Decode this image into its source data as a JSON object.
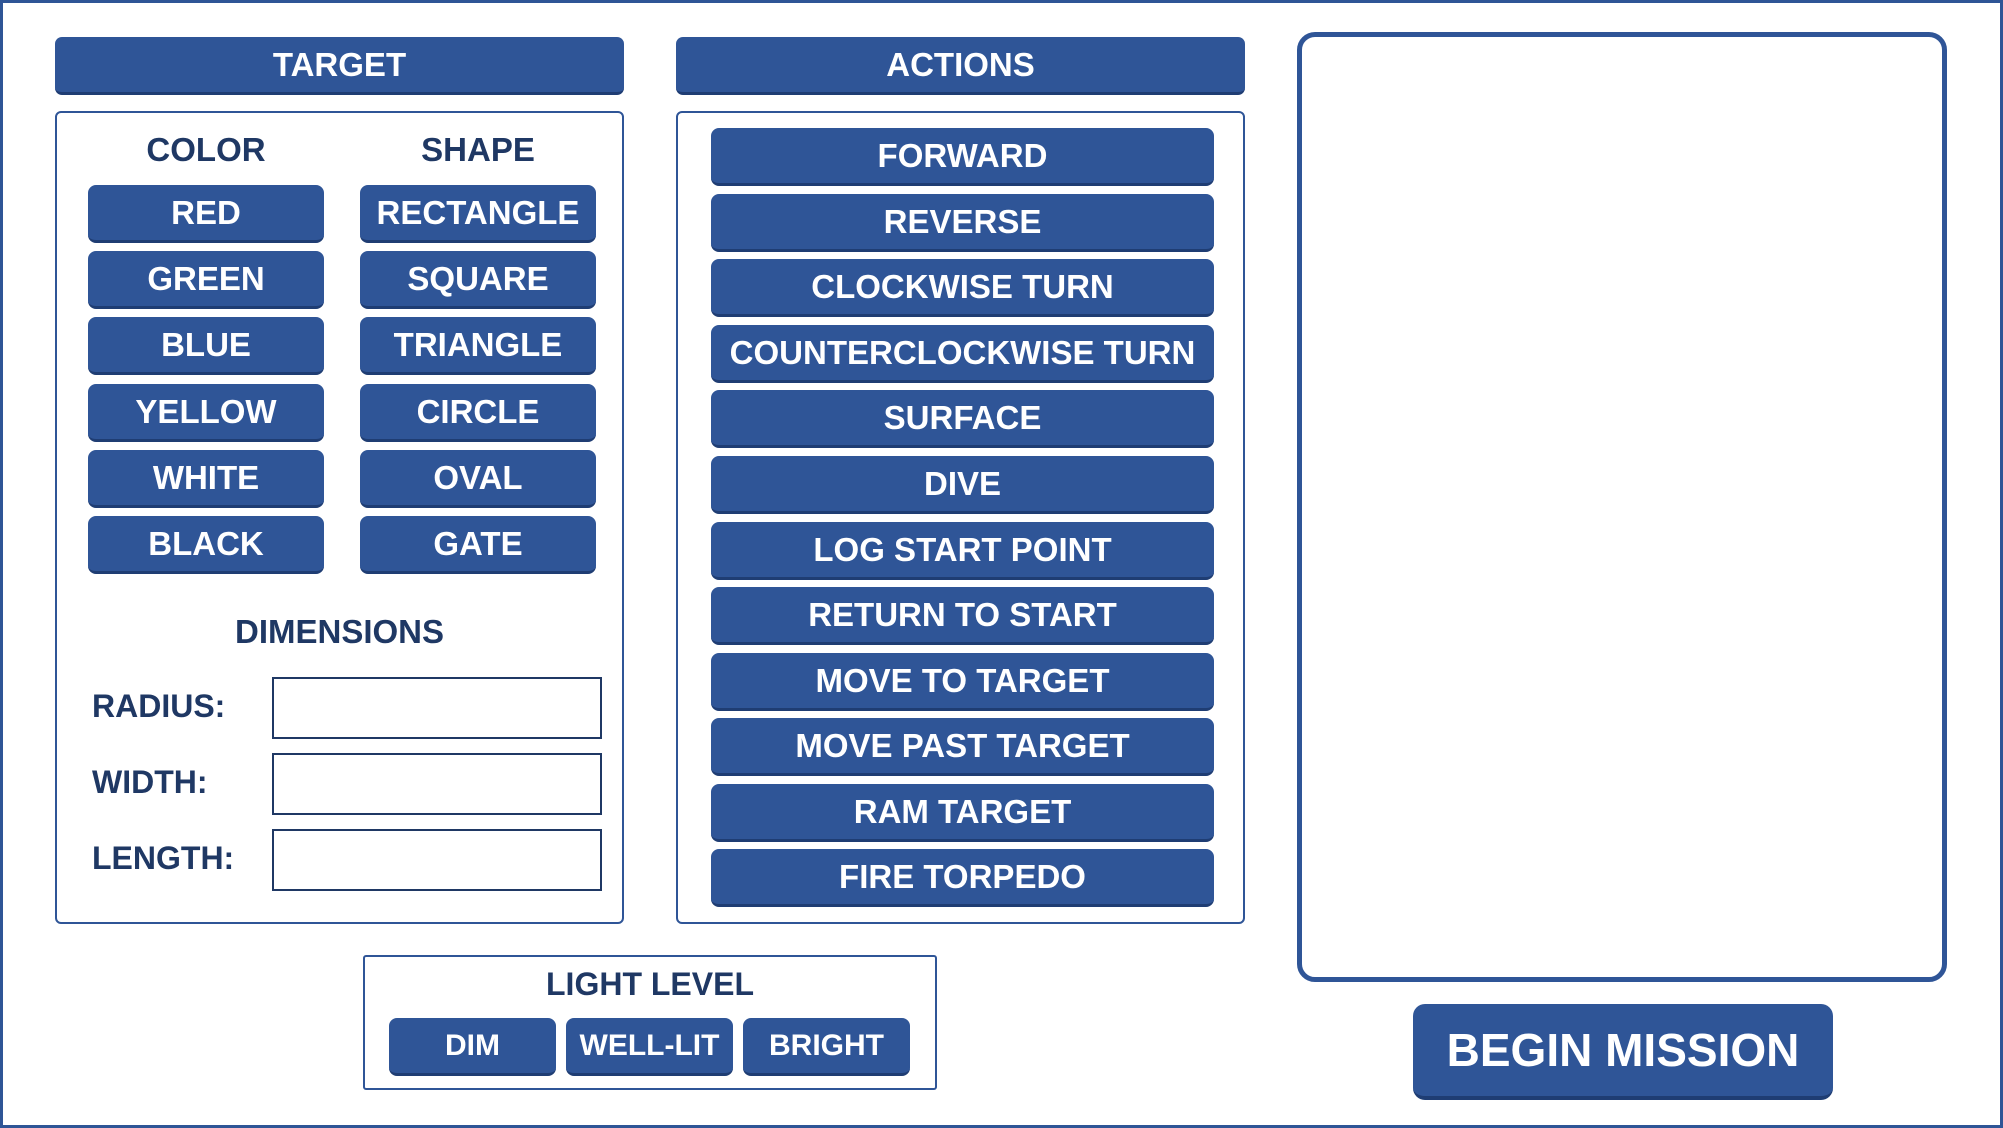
{
  "target": {
    "header": "TARGET",
    "color_heading": "COLOR",
    "shape_heading": "SHAPE",
    "colors": [
      "RED",
      "GREEN",
      "BLUE",
      "YELLOW",
      "WHITE",
      "BLACK"
    ],
    "shapes": [
      "RECTANGLE",
      "SQUARE",
      "TRIANGLE",
      "CIRCLE",
      "OVAL",
      "GATE"
    ],
    "dimensions_heading": "DIMENSIONS",
    "radius_label": "RADIUS:",
    "width_label": "WIDTH:",
    "length_label": "LENGTH:",
    "radius_value": "",
    "width_value": "",
    "length_value": ""
  },
  "actions": {
    "header": "ACTIONS",
    "items": [
      "FORWARD",
      "REVERSE",
      "CLOCKWISE TURN",
      "COUNTERCLOCKWISE TURN",
      "SURFACE",
      "DIVE",
      "LOG START POINT",
      "RETURN TO START",
      "MOVE TO TARGET",
      "MOVE PAST TARGET",
      "RAM TARGET",
      "FIRE TORPEDO"
    ]
  },
  "light": {
    "heading": "LIGHT LEVEL",
    "options": [
      "DIM",
      "WELL-LIT",
      "BRIGHT"
    ]
  },
  "mission": {
    "begin_label": "BEGIN MISSION"
  },
  "colors": {
    "accent": "#2f5597",
    "text_dark": "#1f3864"
  }
}
